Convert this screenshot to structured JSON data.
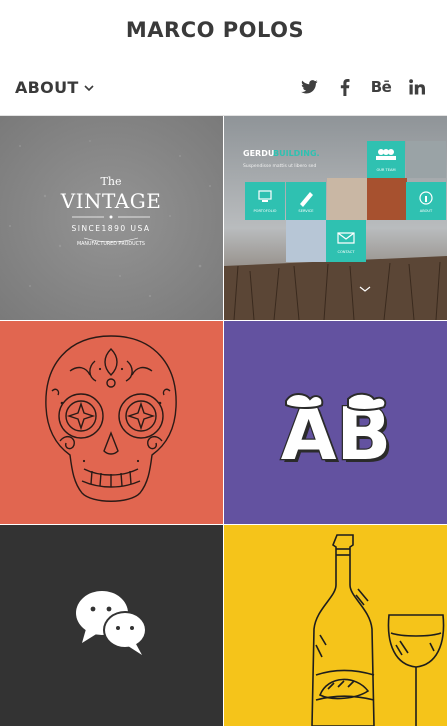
{
  "header": {
    "title": "MARCO POLOS",
    "nav_label": "ABOUT"
  },
  "social": [
    "twitter-icon",
    "facebook-icon",
    "behance-icon",
    "linkedin-icon"
  ],
  "behance_label": "Bē",
  "colors": {
    "text": "#3a3a3a",
    "tile_vintage": "#8b8b8b",
    "tile_website": "#9ba0a3",
    "tile_skull": "#e16650",
    "tile_ab": "#6352a0",
    "tile_chat": "#333333",
    "tile_wine": "#f5c41a",
    "accent_teal": "#2fc1b1"
  },
  "tiles": {
    "vintage": {
      "the": "The",
      "word": "VINTAGE",
      "since": "SINCE1890 USA",
      "tag": "MANUFACTURED PRODUCTS"
    },
    "website": {
      "brand_a": "GERDU",
      "brand_b": "BUILDING.",
      "tagline": "Suspendisse mattis ut libero sed",
      "menu": [
        "OUR TEAM",
        "PORTOFOLIO",
        "SERVICE",
        "ABOUT",
        "CONTACT"
      ]
    },
    "ab": {
      "letters": "AB"
    }
  }
}
